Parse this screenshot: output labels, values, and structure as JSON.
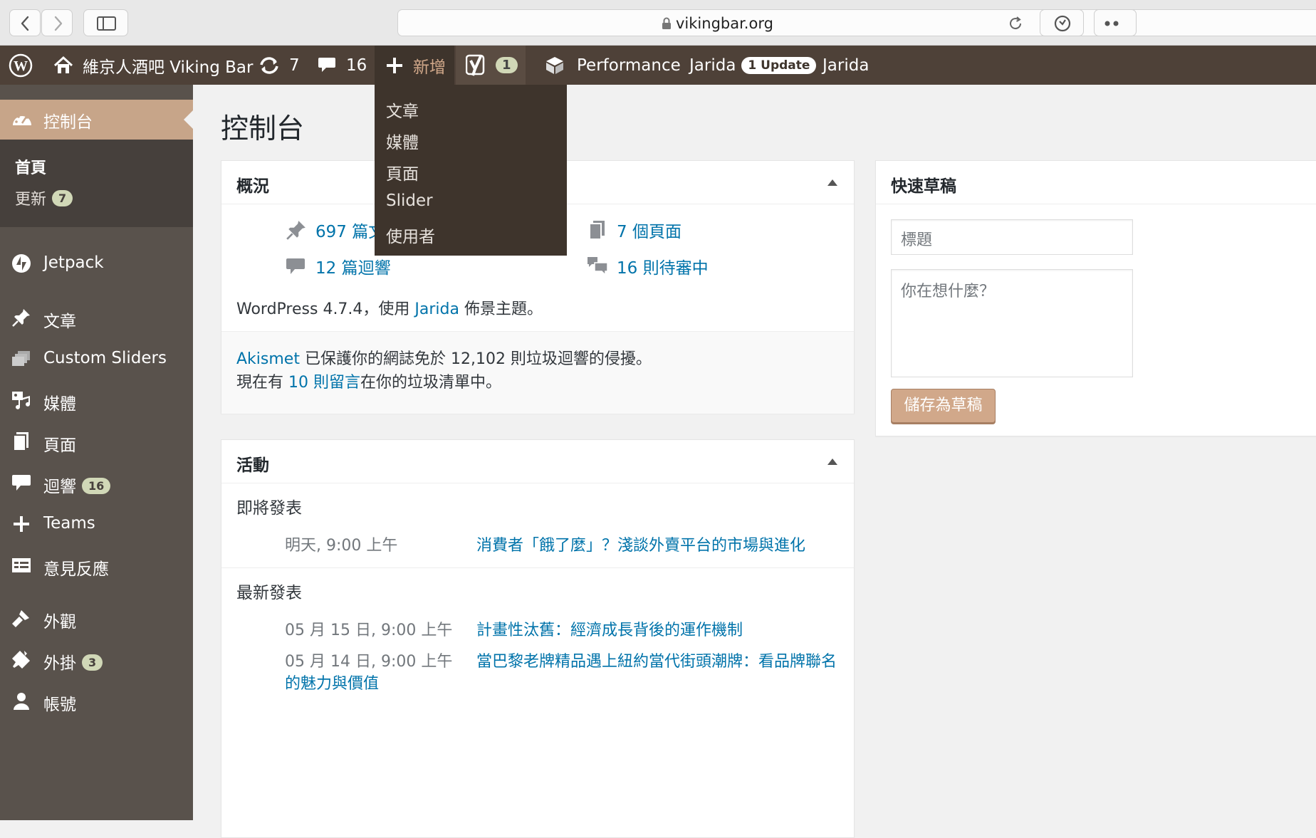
{
  "browser": {
    "url": "vikingbar.org"
  },
  "adminbar": {
    "site_name": "維京人酒吧 Viking Bar",
    "updates_count": "7",
    "comments_count": "16",
    "new_label": "新增",
    "yoast_count": "1",
    "performance_label": "Performance",
    "theme_label": "Jarida",
    "theme_update_badge": "1 Update",
    "theme_label_2": "Jarida"
  },
  "new_menu": {
    "items": [
      "文章",
      "媒體",
      "頁面",
      "Slider",
      "使用者"
    ]
  },
  "sidebar": {
    "dashboard": "控制台",
    "sub_home": "首頁",
    "sub_updates": "更新",
    "sub_updates_badge": "7",
    "items": [
      {
        "label": "Jetpack",
        "icon": "jetpack-icon"
      },
      {
        "label": "文章",
        "icon": "pin-icon"
      },
      {
        "label": "Custom Sliders",
        "icon": "slides-icon"
      },
      {
        "label": "媒體",
        "icon": "media-icon"
      },
      {
        "label": "頁面",
        "icon": "pages-icon"
      },
      {
        "label": "迴響",
        "icon": "comment-icon",
        "badge": "16"
      },
      {
        "label": "Teams",
        "icon": "plus-icon"
      },
      {
        "label": "意見反應",
        "icon": "feedback-icon"
      },
      {
        "label": "外觀",
        "icon": "brush-icon"
      },
      {
        "label": "外掛",
        "icon": "plugin-icon",
        "badge": "3"
      },
      {
        "label": "帳號",
        "icon": "user-icon"
      }
    ]
  },
  "main": {
    "title": "控制台",
    "glance": {
      "heading": "概況",
      "posts": "697 篇文",
      "pages": "7 個頁面",
      "comments": "12 篇迴響",
      "pending": "16 則待審中",
      "wp_prefix": "WordPress 4.7.4，使用",
      "theme_link": "Jarida",
      "wp_suffix": "佈景主題。",
      "akismet_link": "Akismet",
      "akismet_text": "已保護你的網誌免於 12,102 則垃圾迴響的侵擾。",
      "spam_prefix": "現在有",
      "spam_link": "10 則留言",
      "spam_suffix": "在你的垃圾清單中。"
    },
    "activity": {
      "heading": "活動",
      "upcoming_heading": "即將發表",
      "upcoming": [
        {
          "date": "明天, 9:00 上午",
          "title": "消費者「餓了麼」？淺談外賣平台的市場與進化"
        }
      ],
      "recent_heading": "最新發表",
      "recent": [
        {
          "date": "05 月 15 日, 9:00 上午",
          "title": "計畫性汰舊：經濟成長背後的運作機制"
        },
        {
          "date": "05 月 14 日, 9:00 上午",
          "title": "當巴黎老牌精品遇上紐約當代街頭潮牌：看品牌聯名",
          "title_cont": "的魅力與價值"
        }
      ]
    },
    "quick_draft": {
      "heading": "快速草稿",
      "title_placeholder": "標題",
      "content_placeholder": "你在想什麼？",
      "save_label": "儲存為草稿"
    }
  }
}
